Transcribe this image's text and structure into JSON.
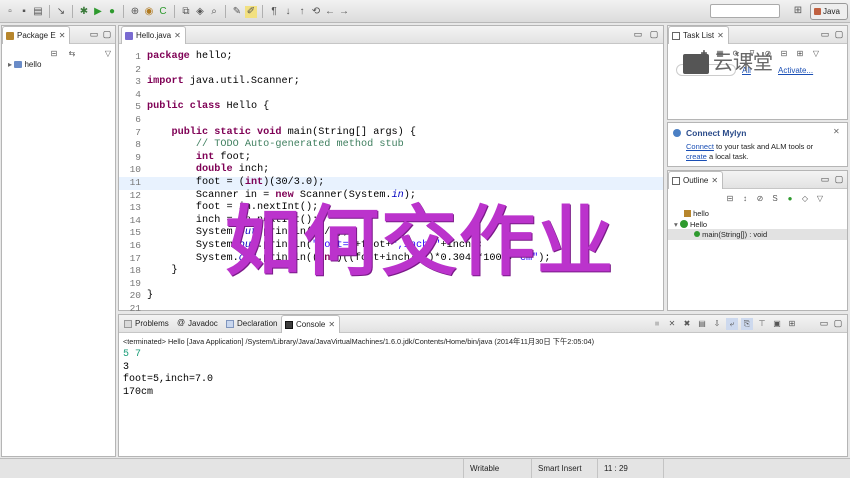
{
  "toolbar": {
    "perspective_label": "Java",
    "search_placeholder": ""
  },
  "package_explorer": {
    "tab_label": "Package E",
    "tree": [
      {
        "label": "hello"
      }
    ]
  },
  "editor": {
    "tab_label": "Hello.java",
    "lines": [
      {
        "n": "1",
        "html": "<span class=\"k\">package</span> hello;"
      },
      {
        "n": "2",
        "html": ""
      },
      {
        "n": "3",
        "html": "<span class=\"k\">import</span> java.util.Scanner;"
      },
      {
        "n": "4",
        "html": ""
      },
      {
        "n": "5",
        "html": "<span class=\"k\">public class</span> Hello {"
      },
      {
        "n": "6",
        "html": ""
      },
      {
        "n": "7",
        "html": "    <span class=\"k\">public static void</span> main(String[] args) {"
      },
      {
        "n": "8",
        "html": "        <span class=\"cm\">// TODO Auto-generated method stub</span>"
      },
      {
        "n": "9",
        "html": "        <span class=\"k\">int</span> foot;"
      },
      {
        "n": "10",
        "html": "        <span class=\"k\">double</span> inch;"
      },
      {
        "n": "11",
        "html": "        foot = (<span class=\"k\">int</span>)(30/3.0);"
      },
      {
        "n": "12",
        "html": "        Scanner in = <span class=\"k\">new</span> Scanner(System.<span class=\"fi\">in</span>);"
      },
      {
        "n": "13",
        "html": "        foot = in.nextInt();"
      },
      {
        "n": "14",
        "html": "        inch = in.nextInt();"
      },
      {
        "n": "15",
        "html": "        System.<span class=\"fi\">out</span>.println(10/3);"
      },
      {
        "n": "16",
        "html": "        System.<span class=\"fi\">out</span>.println(<span class=\"st\">\"foot=\"</span>+foot+<span class=\"st\">\",inch=\"</span>+inch);"
      },
      {
        "n": "17",
        "html": "        System.<span class=\"fi\">out</span>.println((<span class=\"k\">int</span>)((foot+inch/12)*0.3048*100)+<span class=\"st\">\"cm\"</span>);"
      },
      {
        "n": "18",
        "html": "    }"
      },
      {
        "n": "19",
        "html": ""
      },
      {
        "n": "20",
        "html": "}"
      },
      {
        "n": "21",
        "html": ""
      }
    ]
  },
  "task_list": {
    "tab_label": "Task List",
    "find_placeholder": "",
    "all_label": "All",
    "activate_label": "Activate..."
  },
  "mylyn": {
    "title": "Connect Mylyn",
    "link1": "Connect",
    "text1": " to your task and ALM tools or",
    "link2": "create",
    "text2": " a local task."
  },
  "outline": {
    "tab_label": "Outline",
    "items": [
      {
        "label": "hello"
      },
      {
        "label": "Hello"
      },
      {
        "label": "main(String[]) : void"
      }
    ]
  },
  "bottom": {
    "tabs": [
      {
        "label": "Problems"
      },
      {
        "label": "Javadoc"
      },
      {
        "label": "Declaration"
      },
      {
        "label": "Console"
      }
    ],
    "terminated": "<terminated> Hello [Java Application] /System/Library/Java/JavaVirtualMachines/1.6.0.jdk/Contents/Home/bin/java (2014年11月30日 下午2:05:04)",
    "output": [
      {
        "text": "5 7",
        "color": "#1e9e7a"
      },
      {
        "text": "3",
        "color": "#000000"
      },
      {
        "text": "foot=5,inch=7.0",
        "color": "#000000"
      },
      {
        "text": "170cm",
        "color": "#000000"
      }
    ]
  },
  "status": {
    "writable": "Writable",
    "insert_mode": "Smart Insert",
    "position": "11 : 29"
  },
  "overlay": {
    "watermark": "如何交作业",
    "logo": "云课堂"
  }
}
